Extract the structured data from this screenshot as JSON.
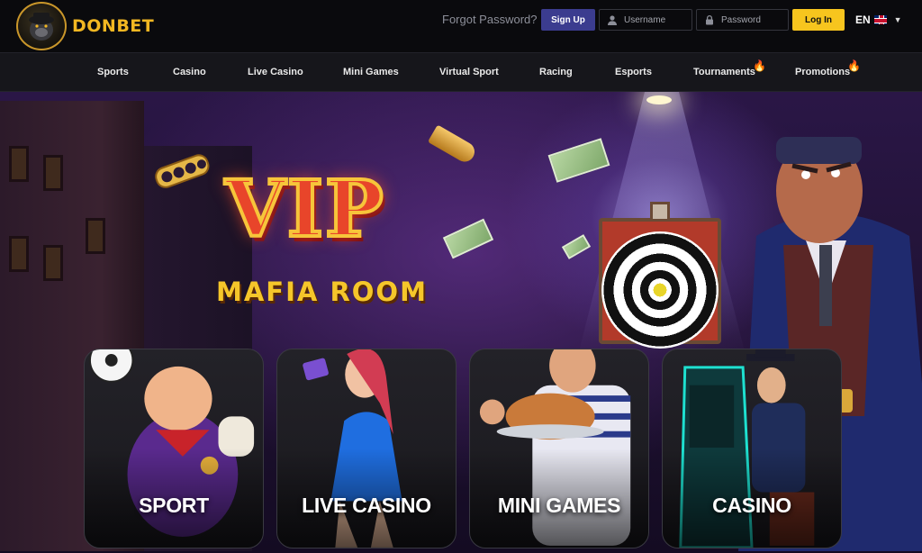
{
  "brand": {
    "name": "DONBET",
    "accent": "#f7c51e",
    "signup_color": "#3b3c8f"
  },
  "header": {
    "forgot_password": "Forgot Password?",
    "signup_label": "Sign Up",
    "username_placeholder": "Username",
    "password_placeholder": "Password",
    "login_label": "Log In",
    "language": "EN"
  },
  "nav": {
    "items": [
      {
        "label": "Sports"
      },
      {
        "label": "Casino"
      },
      {
        "label": "Live Casino"
      },
      {
        "label": "Mini Games"
      },
      {
        "label": "Virtual Sport"
      },
      {
        "label": "Racing"
      },
      {
        "label": "Esports"
      },
      {
        "label": "Tournaments",
        "icon": "fire-icon"
      },
      {
        "label": "Promotions",
        "icon": "fire-icon"
      }
    ]
  },
  "hero": {
    "title": "VIP",
    "subtitle": "MAFIA ROOM"
  },
  "categories": [
    {
      "label": "SPORT"
    },
    {
      "label": "LIVE CASINO"
    },
    {
      "label": "MINI GAMES"
    },
    {
      "label": "CASINO"
    }
  ]
}
